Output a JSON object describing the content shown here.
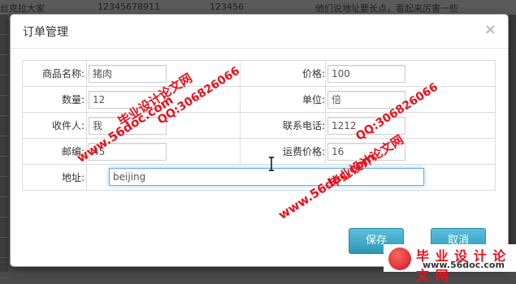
{
  "background_row": {
    "col1": "丝克拉大家",
    "col2": "12345678911",
    "col3": "123456",
    "col4": "他们说地址要长点，看起来厉害一些"
  },
  "modal": {
    "title": "订单管理",
    "close_label": "×"
  },
  "form": {
    "rows": [
      {
        "left_label": "商品名称:",
        "left_value": "猪肉",
        "right_label": "价格:",
        "right_value": "100"
      },
      {
        "left_label": "数量:",
        "left_value": "12",
        "right_label": "单位:",
        "right_value": "倍"
      },
      {
        "left_label": "收件人:",
        "left_value": "我",
        "right_label": "联系电话:",
        "right_value": "1212"
      },
      {
        "left_label": "邮编:",
        "left_value": "45",
        "right_label": "运费价格:",
        "right_value": "16"
      }
    ],
    "address_label": "地址:",
    "address_value": "beijing"
  },
  "footer": {
    "save_label": "保存",
    "cancel_label": "取消"
  },
  "watermark": {
    "site_text": "www.56doc.com",
    "brand_text": "毕业设计论文网",
    "qq_text": "QQ:306826066",
    "logo_brand": "毕 业 设 计 论 文 网",
    "logo_site": "www.56doc.com"
  },
  "colors": {
    "primary_button": "#2f96b4",
    "watermark": "#e8101a",
    "focus_border": "#66afe9"
  }
}
